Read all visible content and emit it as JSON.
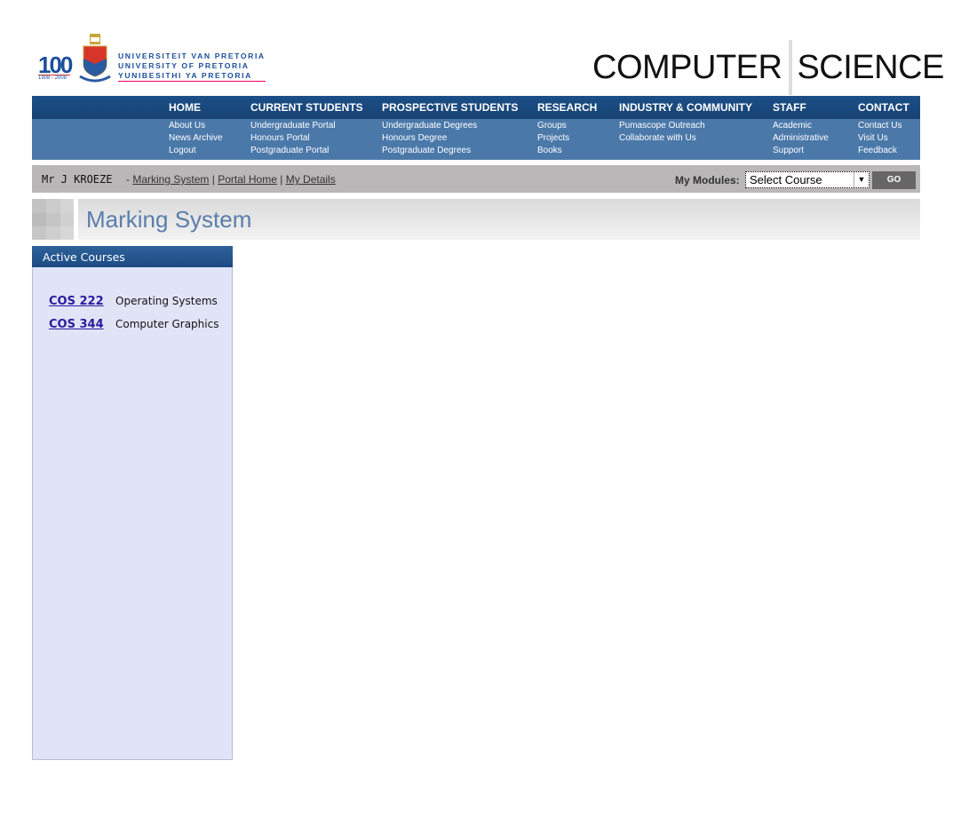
{
  "header": {
    "centenary": "100",
    "centenary_years": "1908 - 2008",
    "university_lines": [
      "UNIVERSITEIT VAN PRETORIA",
      "UNIVERSITY OF PRETORIA",
      "YUNIBESITHI YA PRETORIA"
    ],
    "dept_word1": "COMPUTER",
    "dept_word2": "SCIENCE"
  },
  "nav": [
    {
      "label": "HOME",
      "items": [
        "About Us",
        "News Archive",
        "Logout"
      ]
    },
    {
      "label": "CURRENT STUDENTS",
      "items": [
        "Undergraduate Portal",
        "Honours Portal",
        "Postgraduate Portal"
      ]
    },
    {
      "label": "PROSPECTIVE STUDENTS",
      "items": [
        "Undergraduate Degrees",
        "Honours Degree",
        "Postgraduate Degrees"
      ]
    },
    {
      "label": "RESEARCH",
      "items": [
        "Groups",
        "Projects",
        "Books"
      ]
    },
    {
      "label": "INDUSTRY & COMMUNITY",
      "items": [
        "Pumascope Outreach",
        "Collaborate with Us"
      ]
    },
    {
      "label": "STAFF",
      "items": [
        "Academic",
        "Administrative",
        "Support"
      ]
    },
    {
      "label": "CONTACT",
      "items": [
        "Contact Us",
        "Visit Us",
        "Feedback"
      ]
    }
  ],
  "userbar": {
    "name": "Mr J KROEZE",
    "dash": "-",
    "links": [
      "Marking System",
      "Portal Home",
      "My Details"
    ],
    "sep": "|",
    "modules_label": "My Modules:",
    "select_value": "Select Course",
    "go_label": "GO"
  },
  "page_title": "Marking System",
  "sidebar": {
    "title": "Active Courses",
    "courses": [
      {
        "code": "COS 222",
        "name": "Operating Systems"
      },
      {
        "code": "COS 344",
        "name": "Computer Graphics"
      }
    ]
  }
}
